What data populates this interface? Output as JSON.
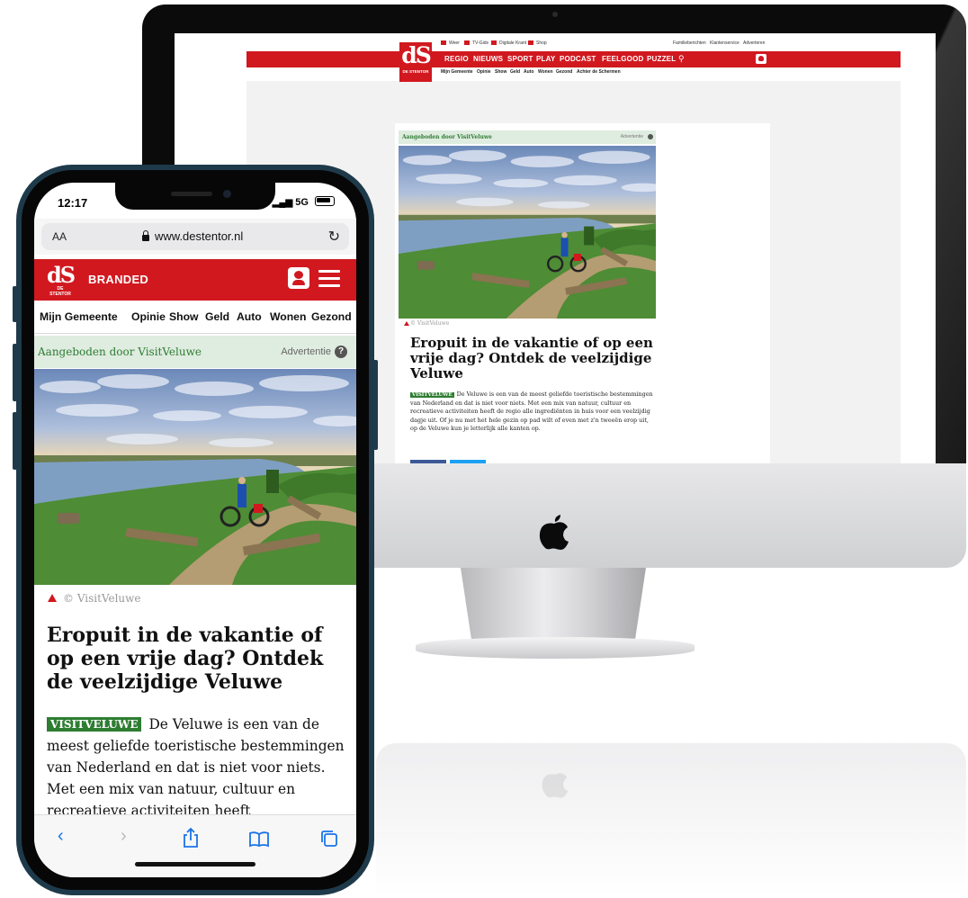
{
  "desktop": {
    "logo": {
      "mark": "dS",
      "name": "DE STENTOR"
    },
    "topbar_left": [
      "Weer",
      "TV-Gids",
      "Digitale Krant",
      "Shop"
    ],
    "topbar_right": [
      "Familieberichten",
      "Klantenservice",
      "Adverteren"
    ],
    "nav": [
      "REGIO",
      "NIEUWS",
      "SPORT",
      "PLAY",
      "PODCAST",
      "FEELGOOD",
      "PUZZEL"
    ],
    "subnav": [
      "Mijn Gemeente",
      "Opinie",
      "Show",
      "Geld",
      "Auto",
      "Wonen",
      "Gezond",
      "Achter de Schermen"
    ],
    "ad_label": "Aangeboden door VisitVeluwe",
    "ad_badge": "Advertentie",
    "credit": "© VisitVeluwe",
    "title": "Eropuit in de vakantie of op een vrije dag? Ontdek de veelzijdige Veluwe",
    "badge": "VISITVELUWE",
    "text": "De Veluwe is een van de meest geliefde toeristische bestemmingen van Nederland en dat is niet voor niets. Met een mix van natuur, cultuur en recreatieve activiteiten heeft de regio alle ingrediënten in huis voor een veelzijdig dagje uit. Of je nu met het hele gezin op pad wilt of even met z'n tweeën erop uit, op de Veluwe kun je letterlijk alle kanten op."
  },
  "phone": {
    "time": "12:17",
    "network": "5G",
    "aa": "AA",
    "url": "www.destentor.nl",
    "logo": {
      "mark": "dS",
      "name": "DE STENTOR"
    },
    "section": "BRANDED",
    "subnav": [
      "Mijn Gemeente",
      "Opinie",
      "Show",
      "Geld",
      "Auto",
      "Wonen",
      "Gezond"
    ],
    "ad_label": "Aangeboden door VisitVeluwe",
    "ad_badge": "Advertentie",
    "help": "?",
    "credit": "© VisitVeluwe",
    "title": "Eropuit in de vakantie of op een vrije dag? Ontdek de veelzijdige Veluwe",
    "badge": "VISITVELUWE",
    "text": "De Veluwe is een van de meest geliefde toeristische bestemmingen van Nederland en dat is niet voor niets. Met een mix van natuur, cultuur en recreatieve activiteiten heeft"
  },
  "colors": {
    "brand_red": "#d1181f",
    "sponsor_green": "#2e7d32",
    "ad_bar": "#dfece0"
  },
  "icons": [
    "apple-logo-icon",
    "lock-icon",
    "reload-icon",
    "user-icon",
    "menu-icon",
    "search-icon",
    "back-icon",
    "forward-icon",
    "share-icon",
    "bookmarks-icon",
    "tabs-icon",
    "help-icon"
  ]
}
